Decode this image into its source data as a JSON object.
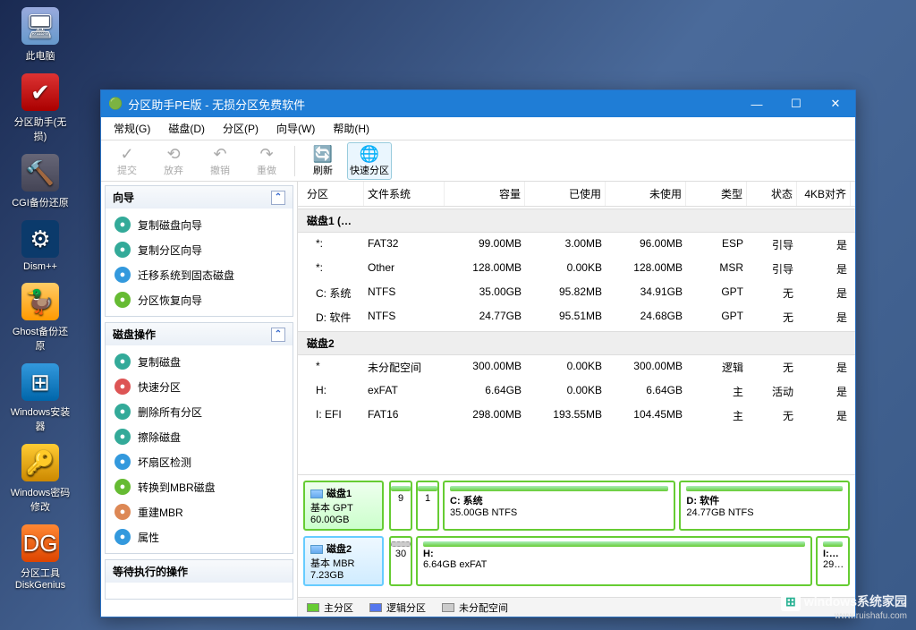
{
  "desktop": [
    {
      "label": "此电脑",
      "cls": "gl-pc",
      "glyph": "🖥"
    },
    {
      "label": "分区助手(无损)",
      "cls": "gl-pa",
      "glyph": "✔"
    },
    {
      "label": "CGI备份还原",
      "cls": "gl-ham",
      "glyph": "🔨"
    },
    {
      "label": "Dism++",
      "cls": "gl-gear",
      "glyph": "⚙"
    },
    {
      "label": "Ghost备份还原",
      "cls": "gl-duck",
      "glyph": "🦆"
    },
    {
      "label": "Windows安装器",
      "cls": "gl-win",
      "glyph": "⊞"
    },
    {
      "label": "Windows密码修改",
      "cls": "gl-key",
      "glyph": "🔑"
    },
    {
      "label": "分区工具DiskGenius",
      "cls": "gl-dg",
      "glyph": "DG"
    }
  ],
  "window": {
    "title": "分区助手PE版 - 无损分区免费软件",
    "menu": [
      "常规(G)",
      "磁盘(D)",
      "分区(P)",
      "向导(W)",
      "帮助(H)"
    ],
    "toolbar": [
      {
        "label": "提交",
        "icon": "✓",
        "disabled": true
      },
      {
        "label": "放弃",
        "icon": "⟲",
        "disabled": true
      },
      {
        "label": "撤销",
        "icon": "↶",
        "disabled": true
      },
      {
        "label": "重做",
        "icon": "↷",
        "disabled": true
      },
      {
        "sep": true
      },
      {
        "label": "刷新",
        "icon": "🔄",
        "disabled": false
      },
      {
        "label": "快速分区",
        "icon": "🌐",
        "disabled": false,
        "selected": true
      }
    ],
    "sidebar": {
      "wizard_title": "向导",
      "wizard": [
        {
          "label": "复制磁盘向导",
          "color": "#3a9"
        },
        {
          "label": "复制分区向导",
          "color": "#3a9"
        },
        {
          "label": "迁移系统到固态磁盘",
          "color": "#39d"
        },
        {
          "label": "分区恢复向导",
          "color": "#6b3"
        }
      ],
      "diskops_title": "磁盘操作",
      "diskops": [
        {
          "label": "复制磁盘",
          "color": "#3a9"
        },
        {
          "label": "快速分区",
          "color": "#d55"
        },
        {
          "label": "删除所有分区",
          "color": "#3a9"
        },
        {
          "label": "擦除磁盘",
          "color": "#3a9"
        },
        {
          "label": "坏扇区检测",
          "color": "#39d"
        },
        {
          "label": "转换到MBR磁盘",
          "color": "#6b3"
        },
        {
          "label": "重建MBR",
          "color": "#d85"
        },
        {
          "label": "属性",
          "color": "#39d"
        }
      ],
      "pending_title": "等待执行的操作"
    },
    "columns": [
      "分区",
      "文件系统",
      "容量",
      "已使用",
      "未使用",
      "类型",
      "状态",
      "4KB对齐"
    ],
    "disk1_label": "磁盘1 (…",
    "disk1": [
      {
        "p": "*:",
        "fs": "FAT32",
        "cap": "99.00MB",
        "used": "3.00MB",
        "free": "96.00MB",
        "type": "ESP",
        "stat": "引导",
        "align": "是"
      },
      {
        "p": "*:",
        "fs": "Other",
        "cap": "128.00MB",
        "used": "0.00KB",
        "free": "128.00MB",
        "type": "MSR",
        "stat": "引导",
        "align": "是"
      },
      {
        "p": "C: 系统",
        "fs": "NTFS",
        "cap": "35.00GB",
        "used": "95.82MB",
        "free": "34.91GB",
        "type": "GPT",
        "stat": "无",
        "align": "是"
      },
      {
        "p": "D: 软件",
        "fs": "NTFS",
        "cap": "24.77GB",
        "used": "95.51MB",
        "free": "24.68GB",
        "type": "GPT",
        "stat": "无",
        "align": "是"
      }
    ],
    "disk2_label": "磁盘2",
    "disk2": [
      {
        "p": "*",
        "fs": "未分配空间",
        "cap": "300.00MB",
        "used": "0.00KB",
        "free": "300.00MB",
        "type": "逻辑",
        "stat": "无",
        "align": "是"
      },
      {
        "p": "H:",
        "fs": "exFAT",
        "cap": "6.64GB",
        "used": "0.00KB",
        "free": "6.64GB",
        "type": "主",
        "stat": "活动",
        "align": "是"
      },
      {
        "p": "I: EFI",
        "fs": "FAT16",
        "cap": "298.00MB",
        "used": "193.55MB",
        "free": "104.45MB",
        "type": "主",
        "stat": "无",
        "align": "是"
      }
    ],
    "map1": {
      "label": "磁盘1",
      "sub": "基本 GPT",
      "size": "60.00GB",
      "small1": "9",
      "small2": "1",
      "p1": {
        "name": "C: 系统",
        "sub": "35.00GB NTFS"
      },
      "p2": {
        "name": "D: 软件",
        "sub": "24.77GB NTFS"
      }
    },
    "map2": {
      "label": "磁盘2",
      "sub": "基本 MBR",
      "size": "7.23GB",
      "small1": "30",
      "p1": {
        "name": "H:",
        "sub": "6.64GB exFAT"
      },
      "p2": {
        "name": "I:…",
        "sub": "29…"
      }
    },
    "legend": [
      "主分区",
      "逻辑分区",
      "未分配空间"
    ]
  },
  "watermark": {
    "text": "windows系统家园",
    "sub": "www.ruishafu.com"
  }
}
